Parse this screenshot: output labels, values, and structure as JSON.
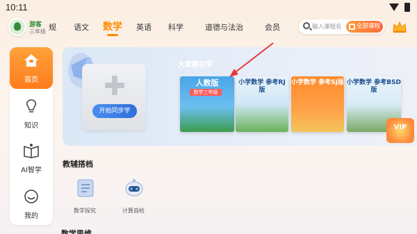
{
  "status_bar": {
    "time": "10:11"
  },
  "user": {
    "name": "游客",
    "grade": "三年级"
  },
  "nav": {
    "tabs": [
      {
        "label": "规"
      },
      {
        "label": "语文"
      },
      {
        "label": "数学"
      },
      {
        "label": "英语"
      },
      {
        "label": "科学"
      },
      {
        "label": "道德与法治"
      },
      {
        "label": "会员"
      }
    ],
    "active_tab": "数学",
    "search_placeholder": "输入课程名",
    "all_courses_label": "全部课程"
  },
  "sidebar": {
    "items": [
      {
        "label": "首页",
        "icon": "home-icon",
        "active": true
      },
      {
        "label": "知识",
        "icon": "lightbulb-icon"
      },
      {
        "label": "AI智学",
        "icon": "book-icon"
      },
      {
        "label": "我的",
        "icon": "smile-icon"
      }
    ]
  },
  "banner": {
    "start_button_label": "开始同步学",
    "everyone_learning_label": "大家都在学",
    "books": [
      {
        "title": "人教版",
        "subtitle": "数学三年级"
      },
      {
        "title": "小学数学 参考RJ版"
      },
      {
        "title": "小学数学 参考SJ版"
      },
      {
        "title": "小学数学 参考BSD版"
      }
    ],
    "vip_label": "VIP"
  },
  "tools_section": {
    "title": "教辅搭档",
    "tools": [
      {
        "label": "数学探究",
        "icon": "scroll-icon"
      },
      {
        "label": "计算自检",
        "icon": "robot-icon"
      }
    ]
  },
  "section2": {
    "title": "数学思维"
  },
  "colors": {
    "accent": "#ff8a00",
    "primary_button": "#2f6fd8",
    "annotation": "#e53935"
  }
}
